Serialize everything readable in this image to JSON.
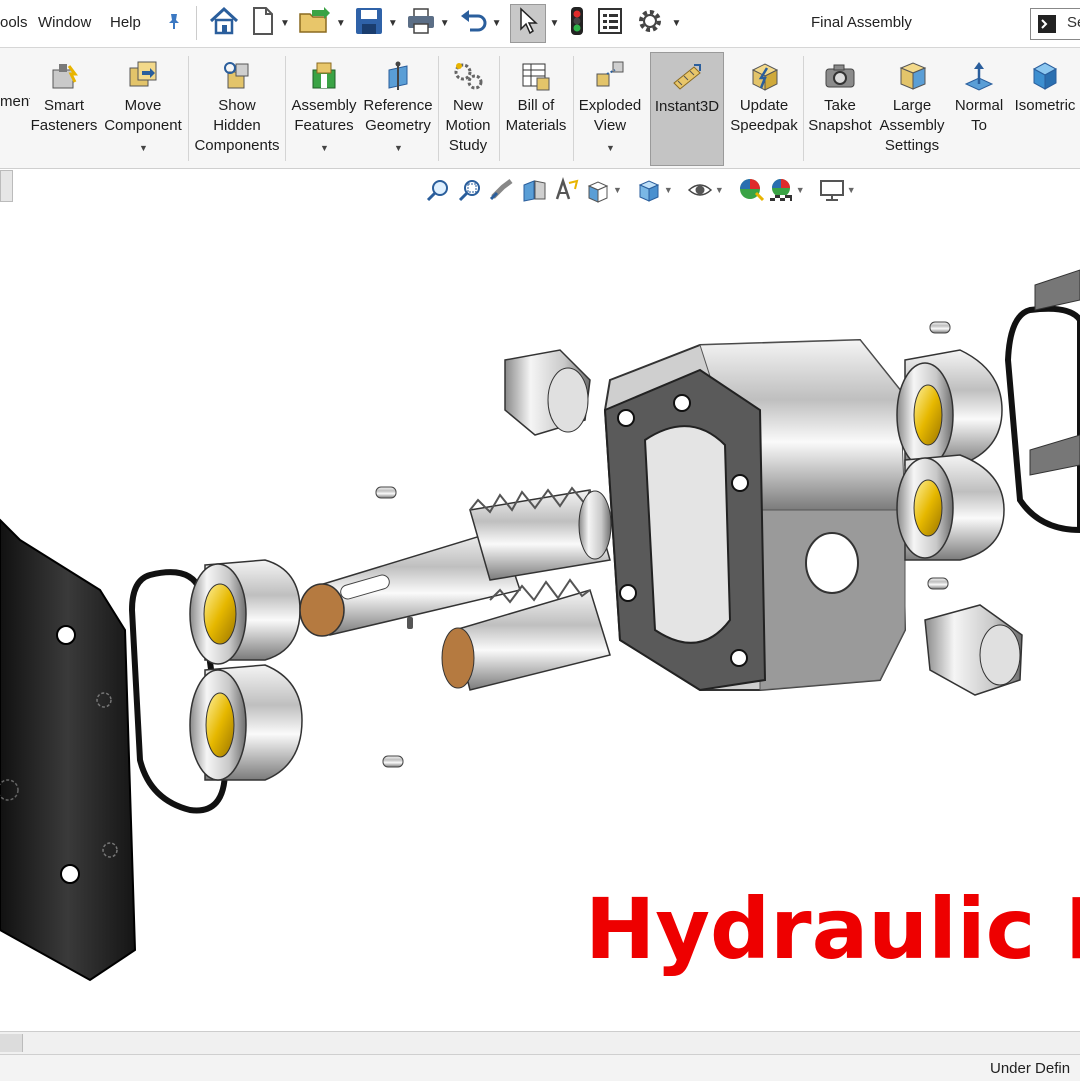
{
  "menu": {
    "tools": "ools",
    "window": "Window",
    "help": "Help"
  },
  "window_title": "Final Assembly",
  "search_placeholder": "Se",
  "ribbon": {
    "items": [
      {
        "label": "ment"
      },
      {
        "label": "Smart\nFasteners"
      },
      {
        "label": "Move\nComponent"
      },
      {
        "label": "Show\nHidden\nComponents"
      },
      {
        "label": "Assembly\nFeatures"
      },
      {
        "label": "Reference\nGeometry"
      },
      {
        "label": "New\nMotion\nStudy"
      },
      {
        "label": "Bill of\nMaterials"
      },
      {
        "label": "Exploded\nView"
      },
      {
        "label": "Instant3D"
      },
      {
        "label": "Update\nSpeedpak"
      },
      {
        "label": "Take\nSnapshot"
      },
      {
        "label": "Large\nAssembly\nSettings"
      },
      {
        "label": "Normal\nTo"
      },
      {
        "label": "Isometric"
      }
    ]
  },
  "watermark": "Hydraulic P",
  "status": {
    "text": "Under Defin"
  },
  "colors": {
    "accent": "#ee0000",
    "ribbon_bg": "#f6f6f6",
    "active_btn": "#c4c4c4"
  }
}
